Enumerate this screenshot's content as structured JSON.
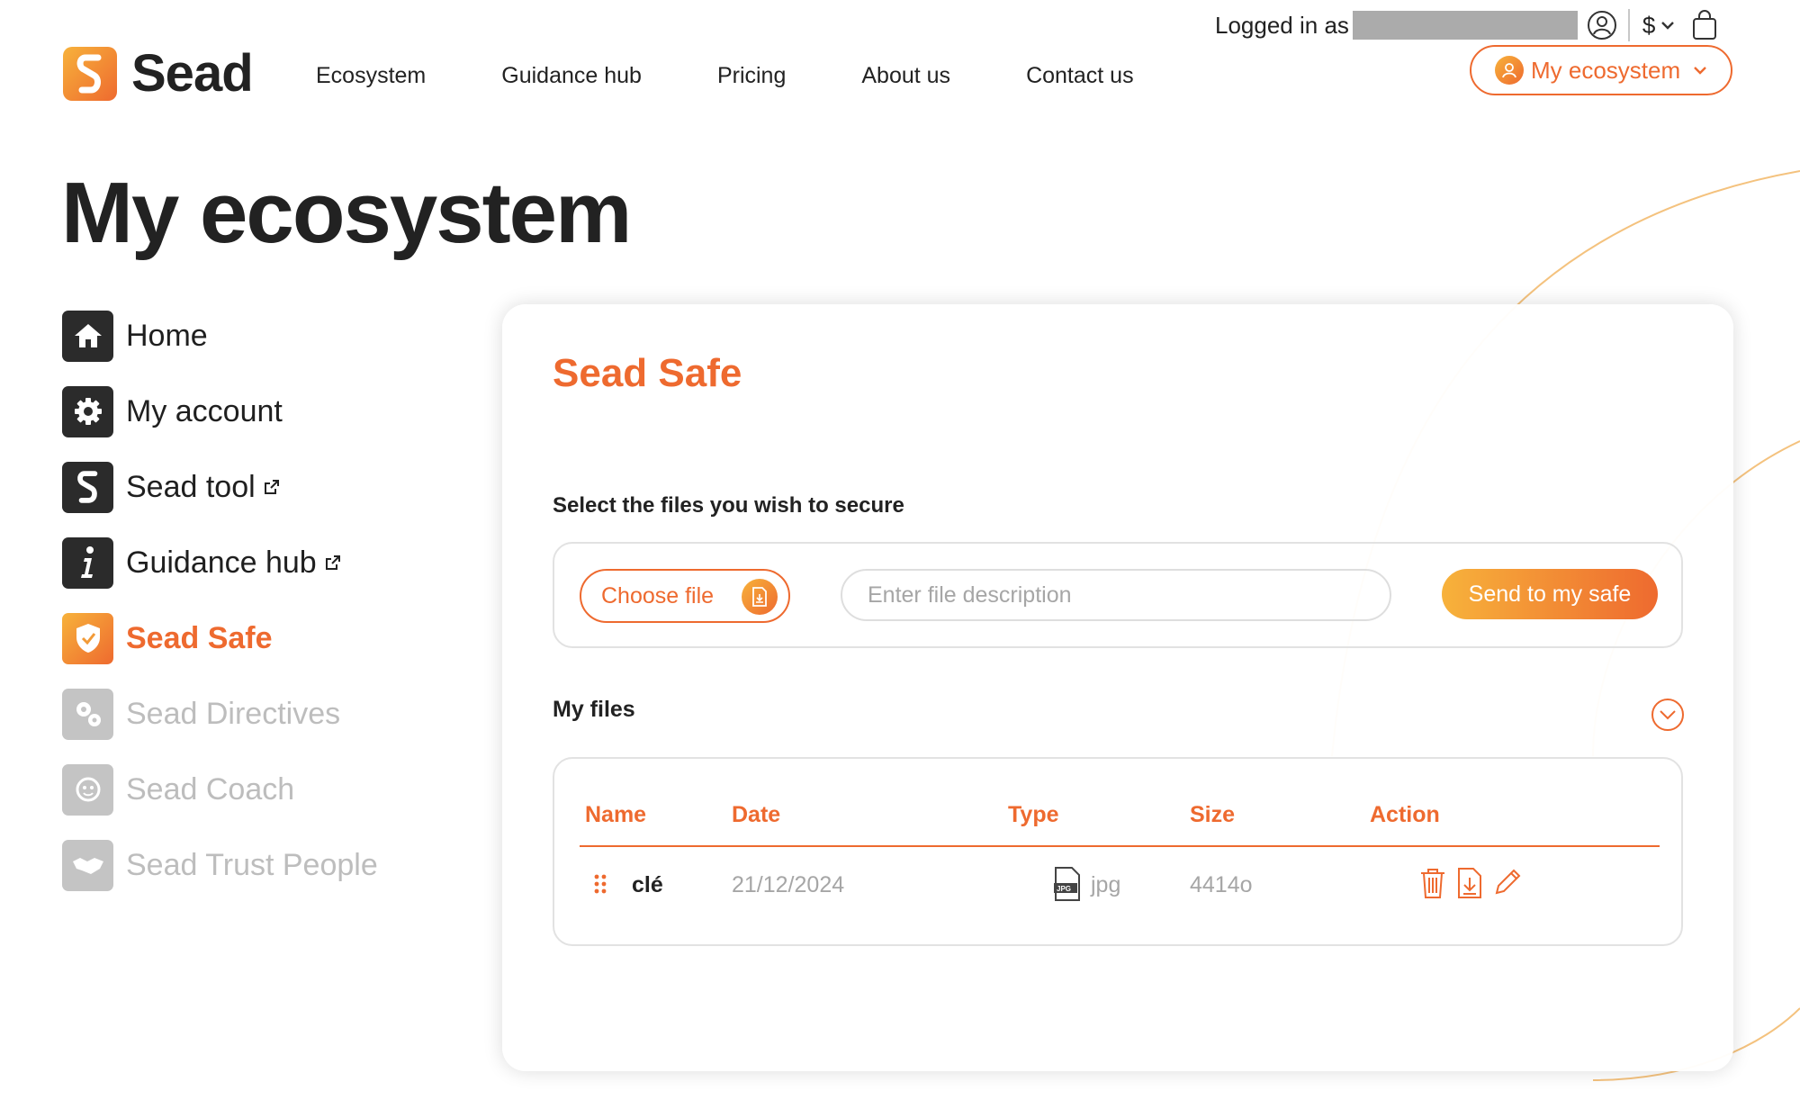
{
  "header": {
    "logged_in_label": "Logged in as",
    "currency_label": "$",
    "brand_name": "Sead",
    "nav": [
      "Ecosystem",
      "Guidance hub",
      "Pricing",
      "About us",
      "Contact us"
    ],
    "ecosystem_button": "My ecosystem"
  },
  "page_title": "My ecosystem",
  "sidebar": {
    "items": [
      {
        "label": "Home",
        "icon": "home-icon",
        "state": "normal"
      },
      {
        "label": "My account",
        "icon": "gear-icon",
        "state": "normal"
      },
      {
        "label": "Sead tool",
        "icon": "sead-logo-icon",
        "state": "normal",
        "external": true
      },
      {
        "label": "Guidance hub",
        "icon": "info-icon",
        "state": "normal",
        "external": true
      },
      {
        "label": "Sead Safe",
        "icon": "shield-check-icon",
        "state": "active"
      },
      {
        "label": "Sead Directives",
        "icon": "gears-icon",
        "state": "disabled"
      },
      {
        "label": "Sead Coach",
        "icon": "coach-face-icon",
        "state": "disabled"
      },
      {
        "label": "Sead Trust People",
        "icon": "handshake-icon",
        "state": "disabled"
      }
    ]
  },
  "safe": {
    "title": "Sead Safe",
    "select_label": "Select the files you wish to secure",
    "choose_file_label": "Choose file",
    "description_placeholder": "Enter file description",
    "send_label": "Send to my safe",
    "my_files_label": "My files",
    "table": {
      "columns": [
        "Name",
        "Date",
        "Type",
        "Size",
        "Action"
      ],
      "rows": [
        {
          "name": "clé",
          "date": "21/12/2024",
          "type": "jpg",
          "size": "4414o"
        }
      ]
    }
  },
  "colors": {
    "accent": "#ee6a2f",
    "accent_light": "#f7b23b",
    "dark": "#2b2b2b",
    "disabled": "#c4c4c4"
  }
}
